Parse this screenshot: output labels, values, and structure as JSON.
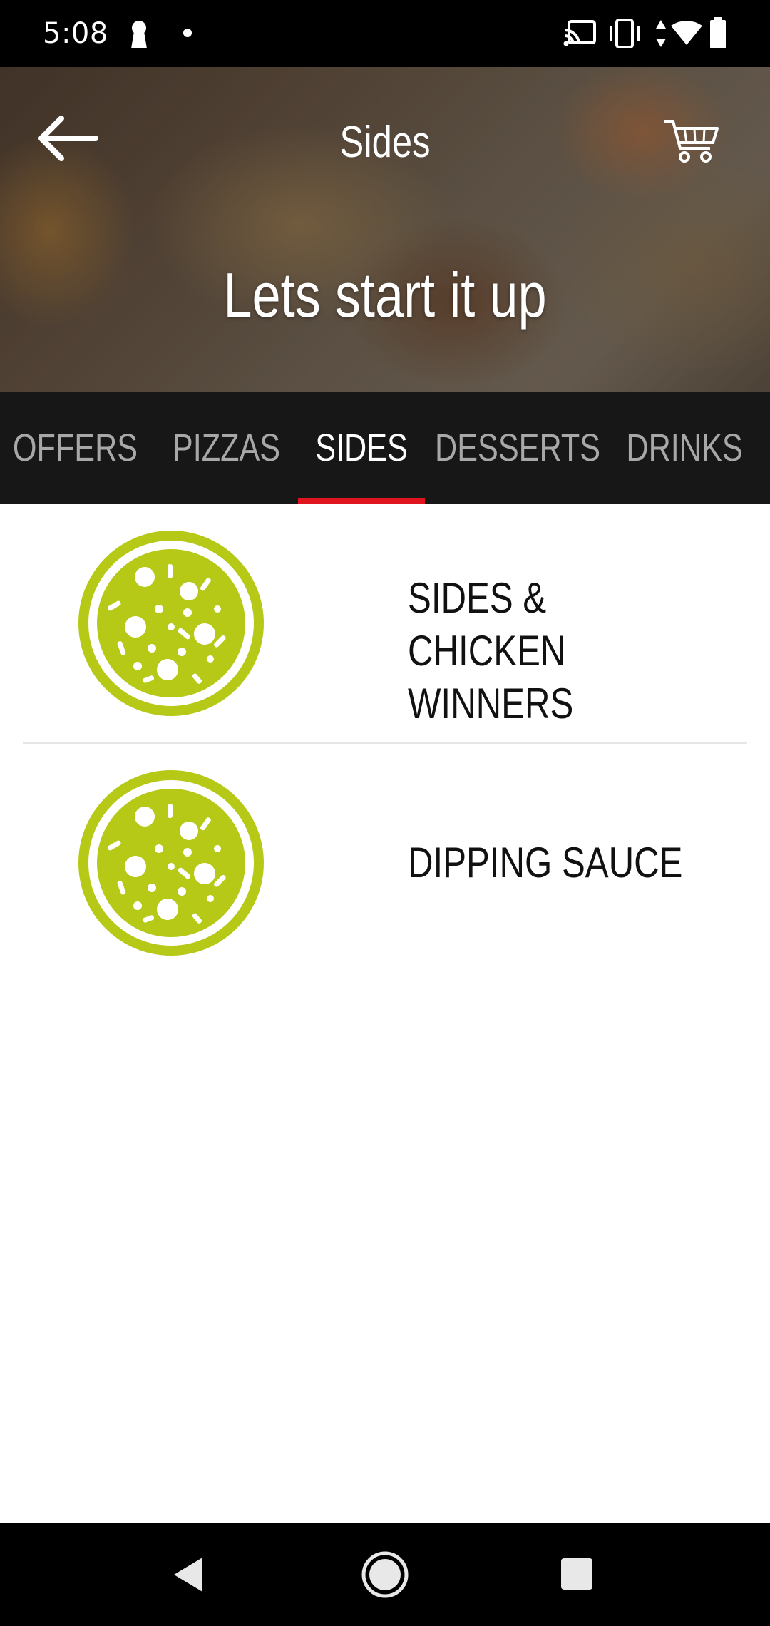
{
  "status_bar": {
    "time": "5:08",
    "icons": [
      "keyhole-icon",
      "notification-dot-icon",
      "cast-icon",
      "vibrate-icon",
      "data-arrows-icon",
      "wifi-icon",
      "battery-icon"
    ]
  },
  "header": {
    "title": "Sides",
    "tagline": "Lets start it up",
    "back_icon": "arrow-left-icon",
    "cart_icon": "cart-icon"
  },
  "tabs": [
    {
      "label": "OFFERS",
      "active": false
    },
    {
      "label": "PIZZAS",
      "active": false
    },
    {
      "label": "SIDES",
      "active": true
    },
    {
      "label": "DESSERTS",
      "active": false
    },
    {
      "label": "DRINKS",
      "active": false
    }
  ],
  "categories": [
    {
      "label": "SIDES & CHICKEN\nWINNERS",
      "icon": "pizza-icon"
    },
    {
      "label": "DIPPING SAUCE",
      "icon": "pizza-icon"
    }
  ],
  "colors": {
    "accent_red": "#e0141e",
    "icon_green": "#b5c916",
    "tab_bar_bg": "#171717"
  },
  "nav_bar": {
    "buttons": [
      "back-triangle-icon",
      "home-circle-icon",
      "recents-square-icon"
    ]
  }
}
